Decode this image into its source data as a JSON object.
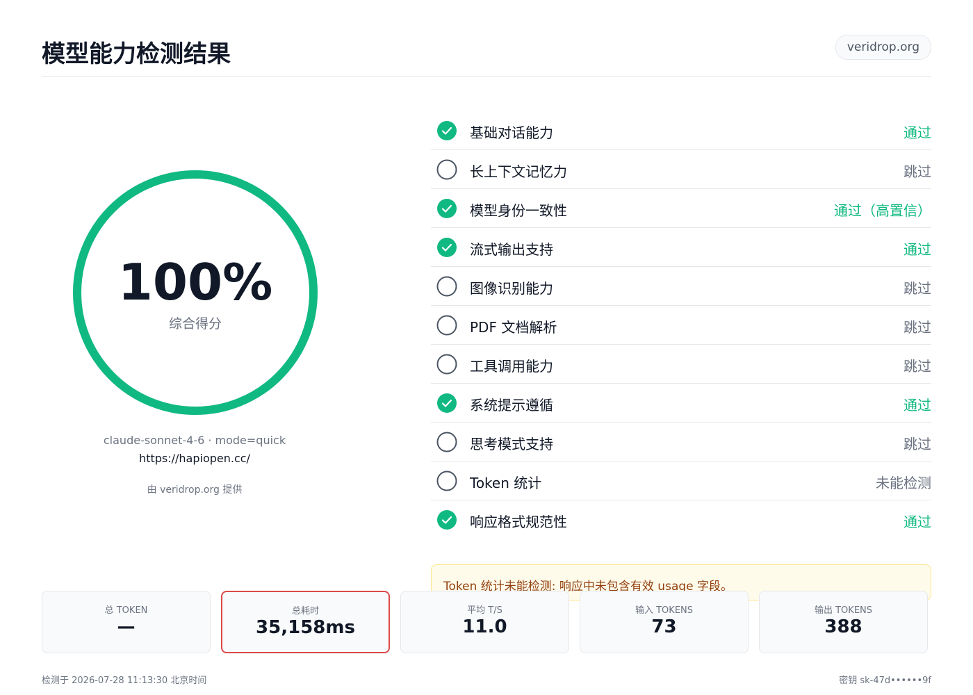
{
  "header": {
    "title": "模型能力检测结果",
    "domain": "veridrop.org"
  },
  "gauge": {
    "percent": 100,
    "value_text": "100%",
    "label": "综合得分",
    "color": "#10b981"
  },
  "meta": {
    "model_line": "claude-sonnet-4-6  ·  mode=quick",
    "url": "https://hapiopen.cc/",
    "powered_by": "由 veridrop.org 提供"
  },
  "checks": [
    {
      "name": "基础对话能力",
      "status": "通过",
      "passed": true
    },
    {
      "name": "长上下文记忆力",
      "status": "跳过",
      "passed": false
    },
    {
      "name": "模型身份一致性",
      "status": "通过（高置信）",
      "passed": true
    },
    {
      "name": "流式输出支持",
      "status": "通过",
      "passed": true
    },
    {
      "name": "图像识别能力",
      "status": "跳过",
      "passed": false
    },
    {
      "name": "PDF 文档解析",
      "status": "跳过",
      "passed": false
    },
    {
      "name": "工具调用能力",
      "status": "跳过",
      "passed": false
    },
    {
      "name": "系统提示遵循",
      "status": "通过",
      "passed": true
    },
    {
      "name": "思考模式支持",
      "status": "跳过",
      "passed": false
    },
    {
      "name": "Token 统计",
      "status": "未能检测",
      "passed": false
    },
    {
      "name": "响应格式规范性",
      "status": "通过",
      "passed": true
    }
  ],
  "warning": "Token 统计未能检测: 响应中未包含有效 usage 字段。",
  "stats": [
    {
      "label": "总 TOKEN",
      "value": "—",
      "highlight": false
    },
    {
      "label": "总耗时",
      "value": "35,158ms",
      "highlight": true
    },
    {
      "label": "平均 T/S",
      "value": "11.0",
      "highlight": false
    },
    {
      "label": "输入 TOKENS",
      "value": "73",
      "highlight": false
    },
    {
      "label": "输出 TOKENS",
      "value": "388",
      "highlight": false
    }
  ],
  "footer": {
    "left": "检测于 2026-07-28 11:13:30 北京时间",
    "right": "密钥 sk-47d••••••9f"
  },
  "colors": {
    "pass": "#10b981",
    "skip": "#6b7280",
    "highlight_border": "#dc4a4a"
  }
}
